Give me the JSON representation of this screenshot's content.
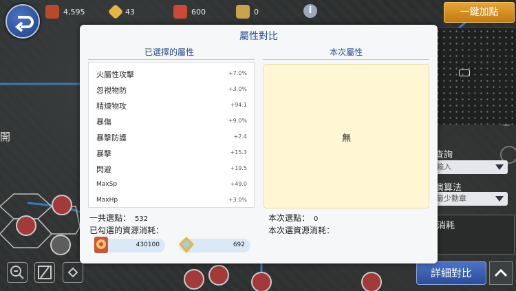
{
  "resources": [
    {
      "icon": "medal-icon",
      "value": "4,595"
    },
    {
      "icon": "crystal-icon",
      "value": "43"
    },
    {
      "icon": "gift-box-icon",
      "value": "600"
    },
    {
      "icon": "locked-crystal-icon",
      "value": "0"
    }
  ],
  "info_icon": "i",
  "onekey_button": "一鍵加點",
  "left_label": "開",
  "right_panel": {
    "query_label": "查詢",
    "query_select": "輸入",
    "calc_label": "演算法",
    "calc_select": "最少勳章",
    "consume_label": "消耗"
  },
  "detail_button": "詳細對比",
  "modal": {
    "title": "屬性對比",
    "selected_header": "已選擇的屬性",
    "current_header": "本次屬性",
    "attributes": [
      {
        "name": "火屬性攻擊",
        "value": "+7.0%"
      },
      {
        "name": "忽視物防",
        "value": "+3.0%"
      },
      {
        "name": "精煉物攻",
        "value": "+94.1"
      },
      {
        "name": "暴傷",
        "value": "+9.0%"
      },
      {
        "name": "暴擊防護",
        "value": "+2.4"
      },
      {
        "name": "暴擊",
        "value": "+15.3"
      },
      {
        "name": "閃避",
        "value": "+19.5"
      },
      {
        "name": "MaxSp",
        "value": "+49.0"
      },
      {
        "name": "MaxHp",
        "value": "+3.0%"
      }
    ],
    "current_none": "無",
    "total_points_label": "一共選點：",
    "total_points_value": "532",
    "selected_cost_label": "已勾選的資源消耗：",
    "current_points_label": "本次選點：",
    "current_points_value": "0",
    "current_cost_label": "本次選資源消耗：",
    "costs": [
      {
        "icon": "medal-icon",
        "value": "430100"
      },
      {
        "icon": "crystal-icon",
        "value": "692"
      }
    ]
  }
}
